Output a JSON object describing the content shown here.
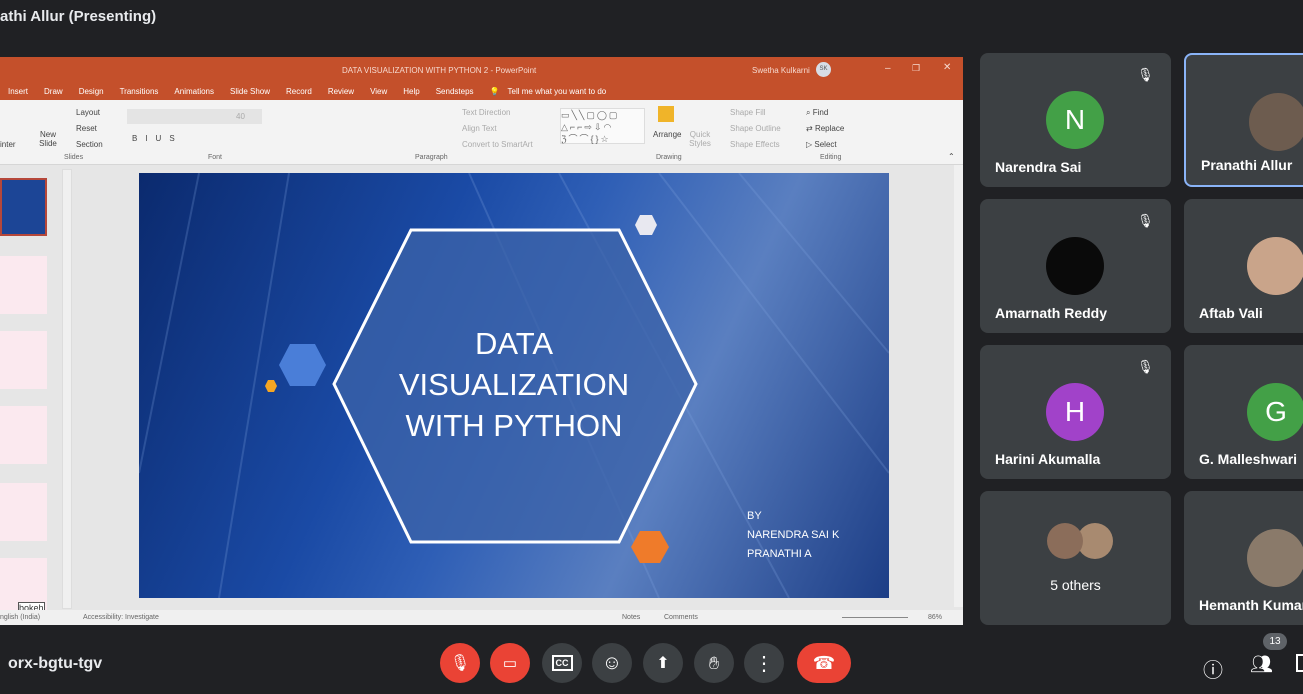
{
  "meeting": {
    "presenter_label": "athi Allur (Presenting)",
    "code": "orx-bgtu-tgv",
    "participant_count": "13"
  },
  "ppt": {
    "title": "DATA VISUALIZATION WITH  PYTHON 2  -  PowerPoint",
    "user": "Swetha Kulkarni",
    "user_initials": "SK",
    "tabs": [
      "Insert",
      "Draw",
      "Design",
      "Transitions",
      "Animations",
      "Slide Show",
      "Record",
      "Review",
      "View",
      "Help",
      "Sendsteps"
    ],
    "tell_me": "Tell me what you want to do",
    "ribbon": {
      "painter": "inter",
      "new_slide": "New Slide",
      "layout": "Layout",
      "reset": "Reset",
      "section": "Section",
      "font_size": "40",
      "text_direction": "Text Direction",
      "align_text": "Align Text",
      "convert_smartart": "Convert to SmartArt",
      "arrange": "Arrange",
      "quick_styles": "Quick Styles",
      "shape_fill": "Shape Fill",
      "shape_outline": "Shape Outline",
      "shape_effects": "Shape Effects",
      "find": "Find",
      "replace": "Replace",
      "select": "Select",
      "groups": {
        "slides": "Slides",
        "font": "Font",
        "paragraph": "Paragraph",
        "drawing": "Drawing",
        "editing": "Editing"
      }
    },
    "slide": {
      "title_lines": [
        "DATA",
        "VISUALIZATION",
        "WITH  PYTHON"
      ],
      "by_lines": [
        "BY",
        "NARENDRA SAI K",
        "PRANATHI A"
      ]
    },
    "thumb_last_label": "bokeh",
    "status": {
      "language": "nglish (India)",
      "accessibility": "Accessibility: Investigate",
      "notes": "Notes",
      "comments": "Comments",
      "zoom": "86%"
    }
  },
  "participants": [
    {
      "name": "Narendra Sai",
      "initial": "N",
      "color": "#43a047",
      "muted": true
    },
    {
      "name": "Pranathi Allur",
      "initial": "",
      "color": "#6d5c4f",
      "muted": false,
      "active": true
    },
    {
      "name": "Amarnath Reddy",
      "initial": "",
      "color": "#0a0a0a",
      "muted": true
    },
    {
      "name": "Aftab Vali",
      "initial": "",
      "color": "#c9a48a",
      "muted": false
    },
    {
      "name": "Harini Akumalla",
      "initial": "H",
      "color": "#a142c9",
      "muted": true
    },
    {
      "name": "G. Malleshwari",
      "initial": "G",
      "color": "#43a047",
      "muted": false
    },
    {
      "name": "5 others",
      "initial": "",
      "color": "#8b6d5a",
      "muted": false
    },
    {
      "name": "Hemanth Kumar",
      "initial": "",
      "color": "#8a7a6a",
      "muted": false
    }
  ],
  "controls": [
    "mic-off",
    "camera-off",
    "captions",
    "emoji",
    "present",
    "raise-hand",
    "more",
    "end-call",
    "info",
    "people",
    "chat"
  ]
}
